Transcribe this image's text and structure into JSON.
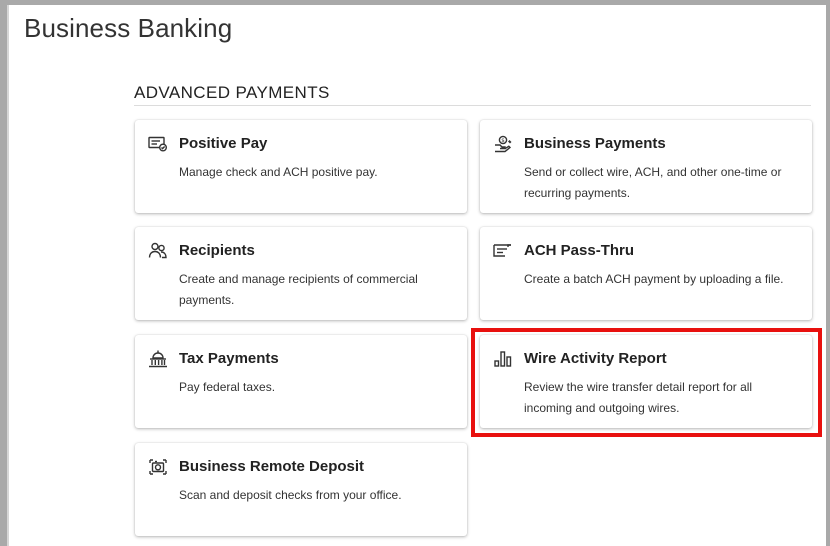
{
  "page": {
    "title": "Business Banking"
  },
  "section": {
    "heading": "ADVANCED PAYMENTS"
  },
  "cards": {
    "positive_pay": {
      "title": "Positive Pay",
      "description": "Manage check and ACH positive pay.",
      "icon": "check-list-icon"
    },
    "business_payments": {
      "title": "Business Payments",
      "description": "Send or collect wire, ACH, and other one-time or recurring payments.",
      "icon": "money-transfer-icon"
    },
    "recipients": {
      "title": "Recipients",
      "description": "Create and manage recipients of commercial payments.",
      "icon": "people-icon"
    },
    "ach_pass_thru": {
      "title": "ACH Pass-Thru",
      "description": "Create a batch ACH payment by uploading a file.",
      "icon": "file-upload-icon"
    },
    "tax_payments": {
      "title": "Tax Payments",
      "description": "Pay federal taxes.",
      "icon": "government-building-icon"
    },
    "wire_activity_report": {
      "title": "Wire Activity Report",
      "description": "Review the wire transfer detail report for all incoming and outgoing wires.",
      "icon": "bar-chart-icon"
    },
    "business_remote_deposit": {
      "title": "Business Remote Deposit",
      "description": "Scan and deposit checks from your office.",
      "icon": "camera-icon"
    }
  },
  "colors": {
    "highlight": "#e8100e",
    "text": "#222222",
    "card_background": "#ffffff"
  }
}
